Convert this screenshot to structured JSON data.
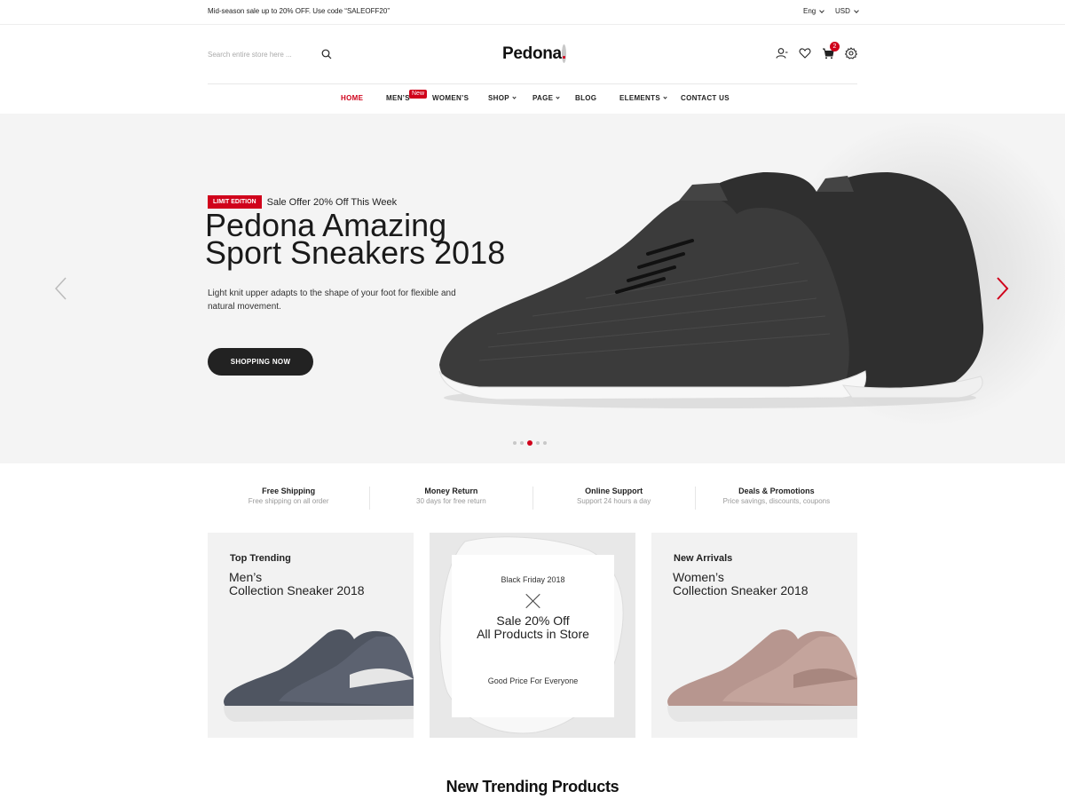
{
  "topbar": {
    "promo": "Mid-season sale up to 20% OFF. Use code “SALEOFF20”",
    "language": "Eng",
    "currency": "USD"
  },
  "header": {
    "search_placeholder": "Search entire store here ...",
    "logo": "Pedona",
    "logo_dot": ".",
    "cart_count": "2",
    "icons": [
      "user-icon",
      "heart-icon",
      "cart-icon",
      "gear-icon"
    ]
  },
  "nav": {
    "items": [
      {
        "label": "HOME",
        "active": true
      },
      {
        "label": "MEN’S",
        "badge": "New"
      },
      {
        "label": "WOMEN’S"
      },
      {
        "label": "SHOP",
        "dropdown": true
      },
      {
        "label": "PAGE",
        "dropdown": true
      },
      {
        "label": "BLOG"
      },
      {
        "label": "ELEMENTS",
        "dropdown": true
      },
      {
        "label": "CONTACT US"
      }
    ],
    "badge": "New"
  },
  "hero": {
    "badge": "LIMIT EDITION",
    "offer": "Sale Offer 20% Off This Week",
    "title_line1": "Pedona Amazing",
    "title_line2": "Sport Sneakers 2018",
    "description": "Light knit upper adapts to the shape of your foot for flexible and natural movement.",
    "button": "SHOPPING NOW",
    "slides": 5,
    "active_slide": 3
  },
  "features": [
    {
      "title": "Free Shipping",
      "subtitle": "Free shipping on all order"
    },
    {
      "title": "Money Return",
      "subtitle": "30 days for free return"
    },
    {
      "title": "Online Support",
      "subtitle": "Support 24 hours a day"
    },
    {
      "title": "Deals & Promotions",
      "subtitle": "Price savings, discounts, coupons"
    }
  ],
  "banners": {
    "left": {
      "kicker": "Top Trending",
      "line1": "Men’s",
      "line2": "Collection Sneaker 2018"
    },
    "middle": {
      "kicker": "Black Friday 2018",
      "line1": "Sale 20% Off",
      "line2": "All Products in Store",
      "footer": "Good Price For Everyone"
    },
    "right": {
      "kicker": "New Arrivals",
      "line1": "Women’s",
      "line2": "Collection Sneaker 2018"
    }
  },
  "section": {
    "title": "New Trending Products"
  },
  "colors": {
    "accent": "#d0021b",
    "dark": "#222222",
    "hero_bg": "#f4f4f4"
  }
}
